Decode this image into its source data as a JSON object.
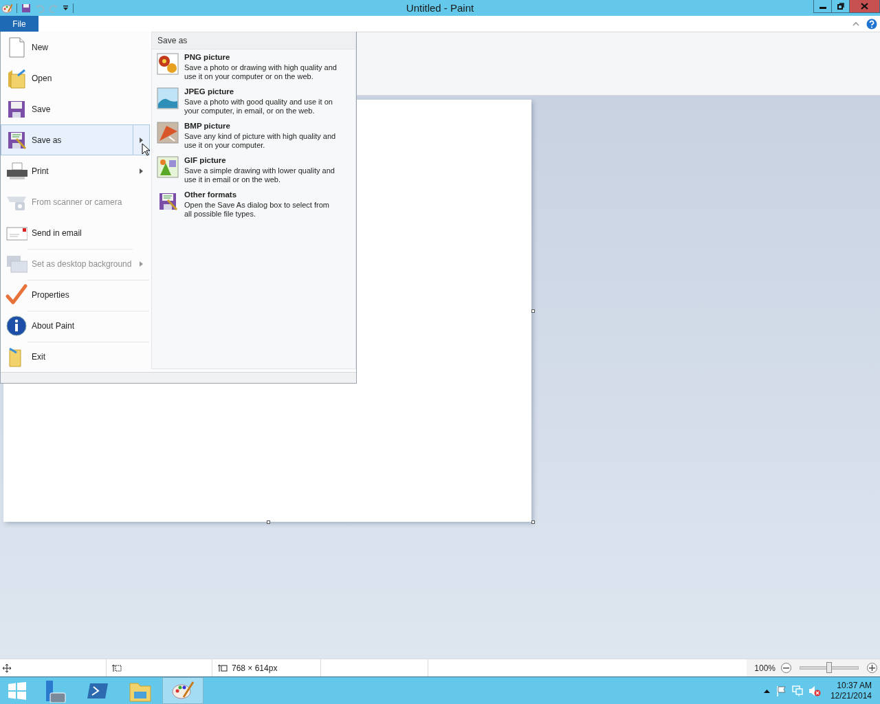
{
  "window": {
    "title": "Untitled - Paint"
  },
  "ribbon": {
    "tabs": [
      {
        "label": "File",
        "selected": true
      }
    ]
  },
  "file_menu": {
    "items": [
      {
        "kind": "new",
        "label": "New",
        "selected": false,
        "disabled": false,
        "submenu": false,
        "separator_before": false
      },
      {
        "kind": "open",
        "label": "Open",
        "selected": false,
        "disabled": false,
        "submenu": false,
        "separator_before": false
      },
      {
        "kind": "save",
        "label": "Save",
        "selected": false,
        "disabled": false,
        "submenu": false,
        "separator_before": false
      },
      {
        "kind": "saveas",
        "label": "Save as",
        "selected": true,
        "disabled": false,
        "submenu": true,
        "separator_before": false
      },
      {
        "kind": "print",
        "label": "Print",
        "selected": false,
        "disabled": false,
        "submenu": true,
        "separator_before": false
      },
      {
        "kind": "scanner",
        "label": "From scanner or camera",
        "selected": false,
        "disabled": true,
        "submenu": false,
        "separator_before": false
      },
      {
        "kind": "email",
        "label": "Send in email",
        "selected": false,
        "disabled": false,
        "submenu": false,
        "separator_before": false
      },
      {
        "kind": "desktop",
        "label": "Set as desktop background",
        "selected": false,
        "disabled": true,
        "submenu": true,
        "separator_before": true
      },
      {
        "kind": "properties",
        "label": "Properties",
        "selected": false,
        "disabled": false,
        "submenu": false,
        "separator_before": true
      },
      {
        "kind": "about",
        "label": "About Paint",
        "selected": false,
        "disabled": false,
        "submenu": false,
        "separator_before": true
      },
      {
        "kind": "exit",
        "label": "Exit",
        "selected": false,
        "disabled": false,
        "submenu": false,
        "separator_before": true
      }
    ]
  },
  "save_as_panel": {
    "heading": "Save as",
    "options": [
      {
        "kind": "png",
        "title": "PNG picture",
        "description": "Save a photo or drawing with high quality and use it on your computer or on the web."
      },
      {
        "kind": "jpeg",
        "title": "JPEG picture",
        "description": "Save a photo with good quality and use it on your computer, in email, or on the web."
      },
      {
        "kind": "bmp",
        "title": "BMP picture",
        "description": "Save any kind of picture with high quality and use it on your computer."
      },
      {
        "kind": "gif",
        "title": "GIF picture",
        "description": "Save a simple drawing with lower quality and use it in email or on the web."
      },
      {
        "kind": "other",
        "title": "Other formats",
        "description": "Open the Save As dialog box to select from all possible file types."
      }
    ]
  },
  "status_bar": {
    "image_size": "768 × 614px",
    "zoom": "100%",
    "zoom_slider": {
      "level": 0.5
    }
  },
  "taskbar": {
    "apps": [
      {
        "kind": "server",
        "selected": false
      },
      {
        "kind": "powershell",
        "selected": false
      },
      {
        "kind": "explorer",
        "selected": false
      },
      {
        "kind": "paint",
        "selected": true
      }
    ],
    "clock": {
      "time": "10:37 AM",
      "date": "12/21/2014"
    }
  }
}
